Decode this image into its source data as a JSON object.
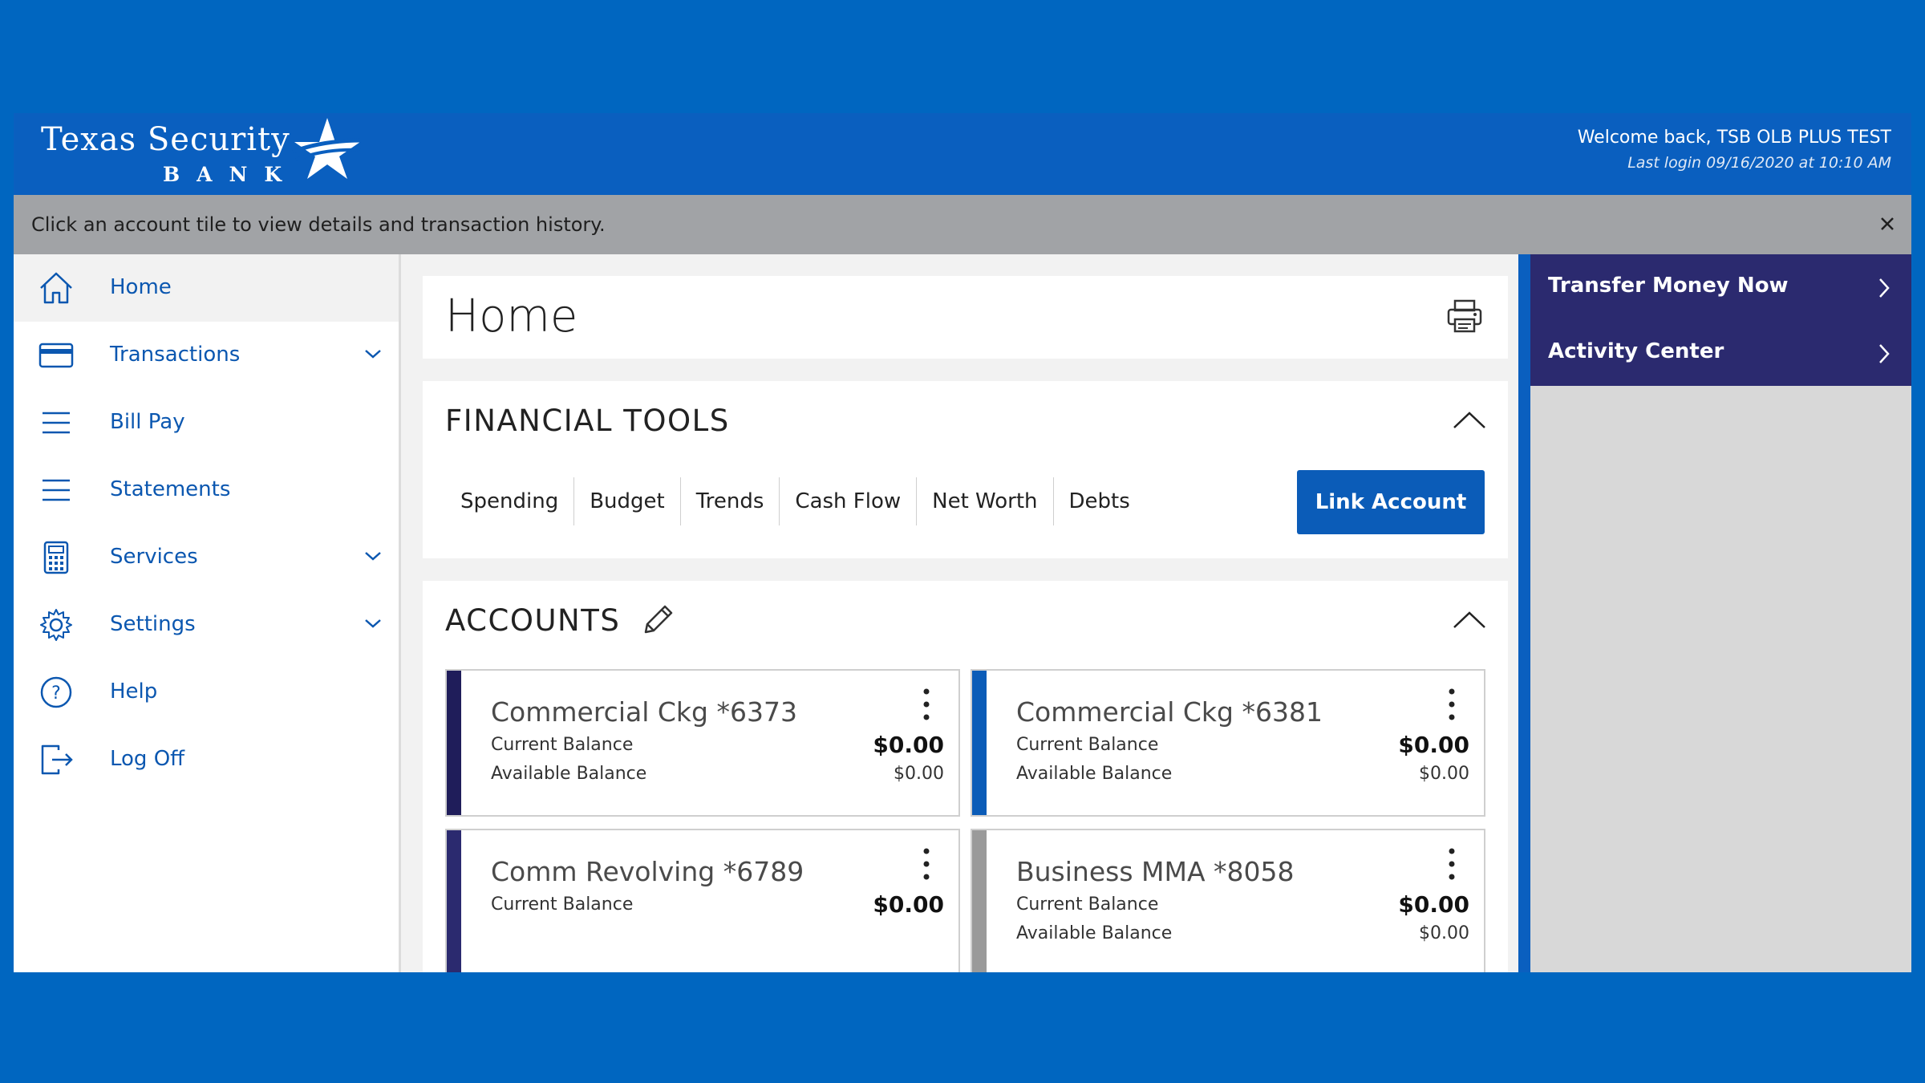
{
  "brand": {
    "line1": "Texas Security",
    "line2": "BANK"
  },
  "header": {
    "welcome": "Welcome back, TSB OLB PLUS TEST",
    "last_login": "Last login 09/16/2020 at 10:10 AM"
  },
  "infobar": {
    "message": "Click an account tile to view details and transaction history."
  },
  "sidebar": {
    "items": [
      {
        "label": "Home",
        "icon": "home-icon"
      },
      {
        "label": "Transactions",
        "icon": "credit-card-icon"
      },
      {
        "label": "Bill Pay",
        "icon": "menu-lines-icon"
      },
      {
        "label": "Statements",
        "icon": "menu-lines-icon"
      },
      {
        "label": "Services",
        "icon": "calculator-icon"
      },
      {
        "label": "Settings",
        "icon": "gear-icon"
      },
      {
        "label": "Help",
        "icon": "help-icon"
      },
      {
        "label": "Log Off",
        "icon": "logout-icon"
      }
    ]
  },
  "main": {
    "page_title": "Home",
    "financial_tools": {
      "title": "FINANCIAL TOOLS",
      "tabs": [
        "Spending",
        "Budget",
        "Trends",
        "Cash Flow",
        "Net Worth",
        "Debts"
      ],
      "link_button": "Link Account"
    },
    "accounts": {
      "title": "ACCOUNTS",
      "list": [
        {
          "name": "Commercial Ckg *6373",
          "label1": "Current Balance",
          "value1": "$0.00",
          "label2": "Available Balance",
          "value2": "$0.00",
          "color": "#1f1d5a"
        },
        {
          "name": "Commercial Ckg *6381",
          "label1": "Current Balance",
          "value1": "$0.00",
          "label2": "Available Balance",
          "value2": "$0.00",
          "color": "#0b5cb8"
        },
        {
          "name": "Comm Revolving *6789",
          "label1": "Current Balance",
          "value1": "$0.00",
          "label2": "",
          "value2": "",
          "color": "#2b2a6f"
        },
        {
          "name": "Business MMA *8058",
          "label1": "Current Balance",
          "value1": "$0.00",
          "label2": "Available Balance",
          "value2": "$0.00",
          "color": "#9a9a9a"
        }
      ]
    }
  },
  "quick_links": [
    {
      "label": "Transfer Money Now"
    },
    {
      "label": "Activity Center"
    }
  ],
  "colors": {
    "page_bg": "#0066c0",
    "header_bg": "#0a5fbf",
    "nav_text": "#0b57b0",
    "button": "#0b5cb8",
    "quick_link_bg": "#2b2a6f"
  }
}
